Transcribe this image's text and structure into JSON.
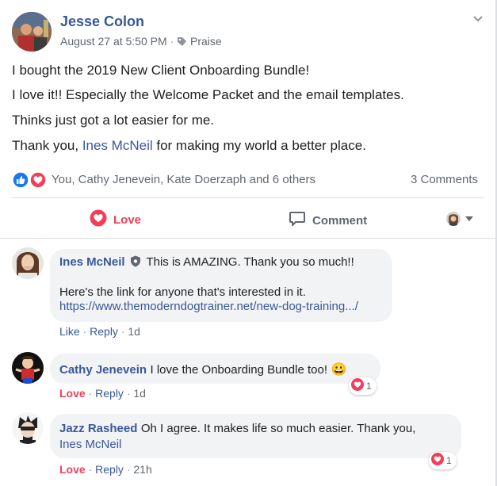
{
  "post": {
    "author": "Jesse Colon",
    "date": "August 27 at 5:50 PM",
    "category": "Praise",
    "lines": [
      "I bought the 2019 New Client Onboarding Bundle!",
      "I love it!! Especially the Welcome Packet and the email templates.",
      "Thinks just got a lot easier for me."
    ],
    "last_line_prefix": "Thank you, ",
    "last_line_mention": "Ines McNeil",
    "last_line_suffix": " for making my world a better place.",
    "reactions_text": "You, Cathy Jenevein, Kate Doerzaph and 6 others",
    "comments_count": "3 Comments",
    "love_label": "Love",
    "comment_label": "Comment"
  },
  "comments": [
    {
      "name": "Ines McNeil",
      "text": "This is AMAZING. Thank you so much!!",
      "text2": "Here's the link for anyone that's interested in it.",
      "link": "https://www.themoderndogtrainer.net/new-dog-training.../",
      "action1": "Like",
      "reply": "Reply",
      "time": "1d"
    },
    {
      "name": "Cathy Jenevein",
      "text": "I love the Onboarding Bundle too!",
      "emoji": "😀",
      "action1": "Love",
      "reply": "Reply",
      "time": "1d",
      "reaction_count": "1"
    },
    {
      "name": "Jazz Rasheed",
      "text": "Oh I agree. It makes life so much easier. Thank you,",
      "mention": "Ines McNeil",
      "action1": "Love",
      "reply": "Reply",
      "time": "21h",
      "reaction_count": "1"
    }
  ],
  "colors": {
    "link": "#385898",
    "love": "#f33e58",
    "like": "#1877f2",
    "bubble": "#f2f3f5"
  },
  "icons": [
    "chevron-down-icon",
    "tag-icon",
    "like-reaction-icon",
    "love-reaction-icon",
    "heart-icon",
    "comment-icon",
    "shield-badge-icon",
    "caret-down-icon"
  ]
}
